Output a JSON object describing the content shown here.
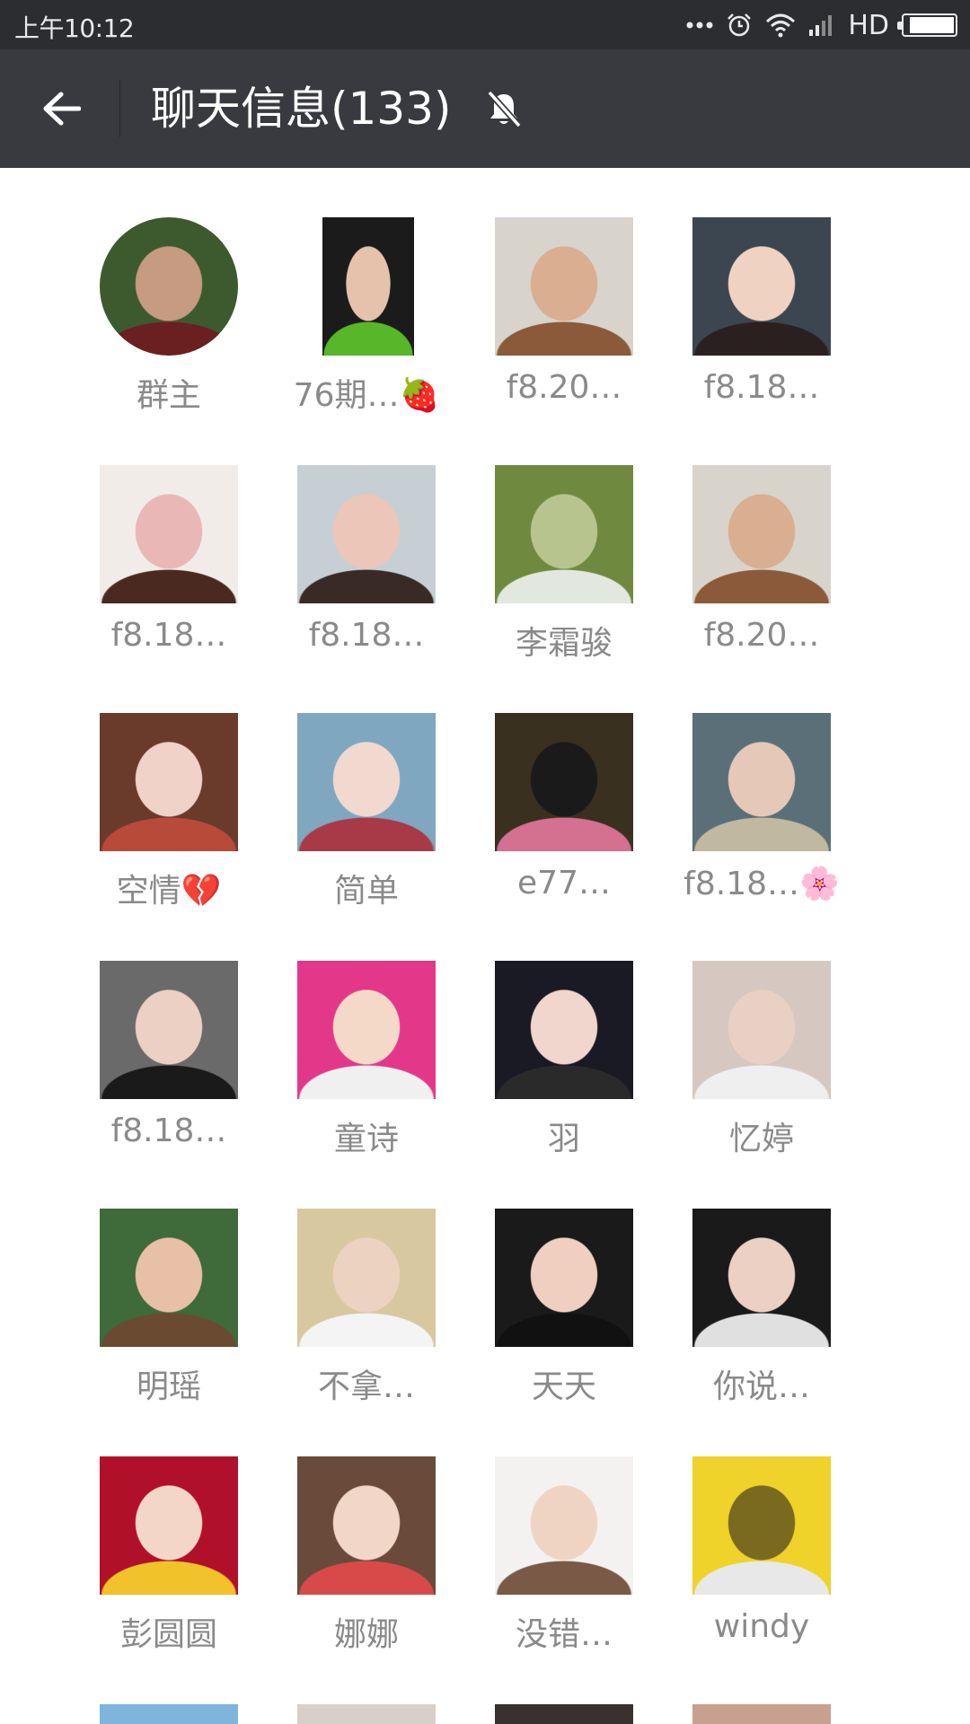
{
  "status_bar": {
    "time": "上午10:12",
    "network_label": "HD",
    "battery_level": 0.85,
    "icons": [
      "more-dots-icon",
      "alarm-icon",
      "wifi-icon",
      "signal-icon",
      "battery-icon"
    ]
  },
  "header": {
    "title": "聊天信息(133)",
    "back_icon": "arrow-left-icon",
    "mute_icon": "bell-off-icon"
  },
  "colors": {
    "status_bar_bg": "#2c2d31",
    "title_bar_bg": "#393a3f",
    "name_text": "#8a8a8a",
    "page_bg": "#ffffff"
  },
  "members": [
    {
      "name": "群主"
    },
    {
      "name": "76期…🍓"
    },
    {
      "name": "f8.20…"
    },
    {
      "name": "f8.18…"
    },
    {
      "name": "f8.18…"
    },
    {
      "name": "f8.18…"
    },
    {
      "name": "李霜骏"
    },
    {
      "name": "f8.20…"
    },
    {
      "name": "空情💔"
    },
    {
      "name": "简单"
    },
    {
      "name": "e77…"
    },
    {
      "name": "f8.18…🌸"
    },
    {
      "name": "f8.18…"
    },
    {
      "name": "童诗"
    },
    {
      "name": "羽"
    },
    {
      "name": "忆婷"
    },
    {
      "name": "明瑶"
    },
    {
      "name": "不拿…"
    },
    {
      "name": "天天"
    },
    {
      "name": "你说…"
    },
    {
      "name": "彭圆圆"
    },
    {
      "name": "娜娜"
    },
    {
      "name": "没错…"
    },
    {
      "name": "windy"
    }
  ]
}
